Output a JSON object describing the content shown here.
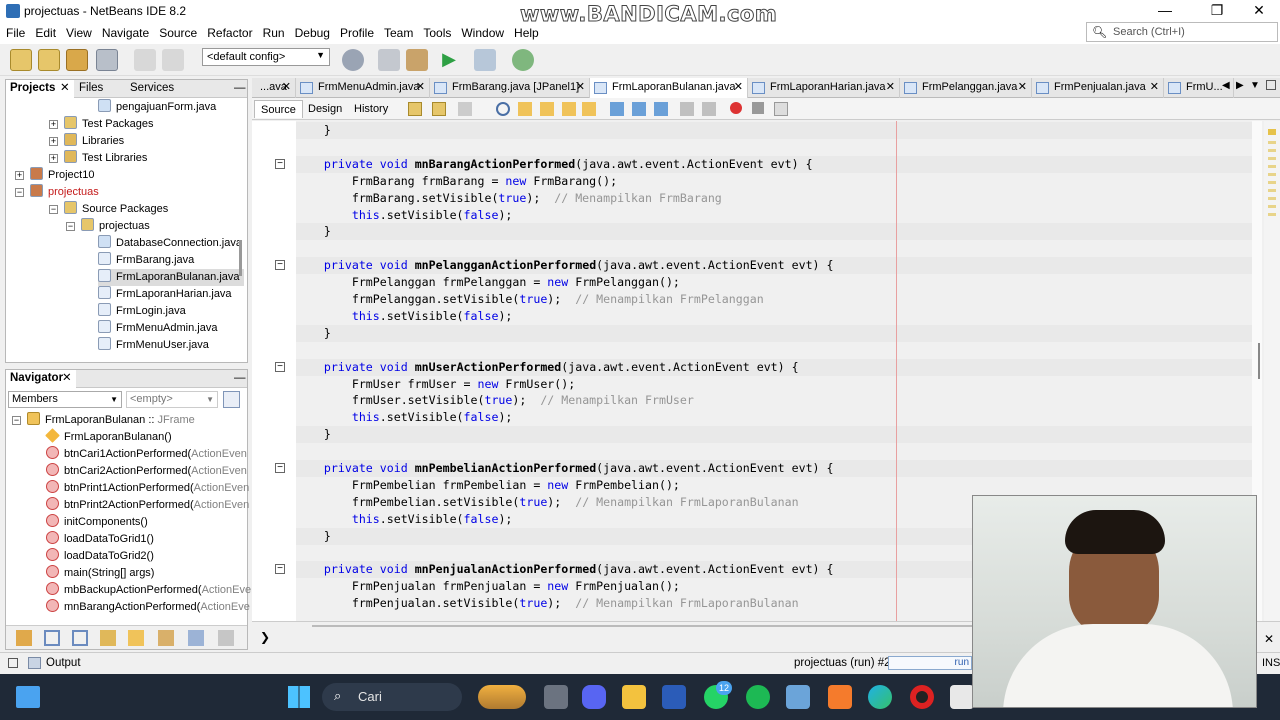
{
  "window": {
    "title": "projectuas - NetBeans IDE 8.2",
    "minimize": "—",
    "maximize": "❐",
    "close": "✕"
  },
  "watermark": "www.BANDICAM.com",
  "menu": [
    "File",
    "Edit",
    "View",
    "Navigate",
    "Source",
    "Refactor",
    "Run",
    "Debug",
    "Profile",
    "Team",
    "Tools",
    "Window",
    "Help"
  ],
  "search": {
    "placeholder": "Search (Ctrl+I)"
  },
  "toolbar": {
    "config": "<default config>"
  },
  "projects_panel": {
    "tabs": [
      "Projects",
      "Files",
      "Services"
    ],
    "minimize": "—",
    "tree": [
      {
        "label": "pengajuanForm.java",
        "indent": 4,
        "icon": "java-file-icon",
        "expander": ""
      },
      {
        "label": "Test Packages",
        "indent": 2,
        "icon": "package-folder-icon",
        "expander": "+"
      },
      {
        "label": "Libraries",
        "indent": 2,
        "icon": "library-icon",
        "expander": "+"
      },
      {
        "label": "Test Libraries",
        "indent": 2,
        "icon": "library-icon",
        "expander": "+"
      },
      {
        "label": "Project10",
        "indent": 0,
        "icon": "project-icon",
        "expander": "+"
      },
      {
        "label": "projectuas",
        "indent": 0,
        "icon": "project-icon",
        "expander": "−",
        "red": true
      },
      {
        "label": "Source Packages",
        "indent": 2,
        "icon": "package-folder-icon",
        "expander": "−"
      },
      {
        "label": "projectuas",
        "indent": 3,
        "icon": "package-icon",
        "expander": "−"
      },
      {
        "label": "DatabaseConnection.java",
        "indent": 4,
        "icon": "java-file-icon",
        "expander": ""
      },
      {
        "label": "FrmBarang.java",
        "indent": 4,
        "icon": "form-file-icon",
        "expander": ""
      },
      {
        "label": "FrmLaporanBulanan.java",
        "indent": 4,
        "icon": "form-file-icon",
        "expander": "",
        "selected": true
      },
      {
        "label": "FrmLaporanHarian.java",
        "indent": 4,
        "icon": "form-file-icon",
        "expander": ""
      },
      {
        "label": "FrmLogin.java",
        "indent": 4,
        "icon": "form-file-icon",
        "expander": ""
      },
      {
        "label": "FrmMenuAdmin.java",
        "indent": 4,
        "icon": "form-file-icon",
        "expander": ""
      },
      {
        "label": "FrmMenuUser.java",
        "indent": 4,
        "icon": "form-file-icon",
        "expander": ""
      }
    ]
  },
  "navigator_panel": {
    "title": "Navigator",
    "minimize": "—",
    "members_select": "Members",
    "filter_select": "<empty>",
    "root": "FrmLaporanBulanan :: ",
    "root_type": "JFrame",
    "items": [
      {
        "name": "FrmLaporanBulanan()",
        "suffix": "",
        "icon": "constructor-icon"
      },
      {
        "name": "btnCari1ActionPerformed(",
        "suffix": "ActionEven",
        "icon": "private-method-icon"
      },
      {
        "name": "btnCari2ActionPerformed(",
        "suffix": "ActionEven",
        "icon": "private-method-icon"
      },
      {
        "name": "btnPrint1ActionPerformed(",
        "suffix": "ActionEven",
        "icon": "private-method-icon"
      },
      {
        "name": "btnPrint2ActionPerformed(",
        "suffix": "ActionEven",
        "icon": "private-method-icon"
      },
      {
        "name": "initComponents()",
        "suffix": "",
        "icon": "private-method-icon"
      },
      {
        "name": "loadDataToGrid1()",
        "suffix": "",
        "icon": "private-method-icon"
      },
      {
        "name": "loadDataToGrid2()",
        "suffix": "",
        "icon": "private-method-icon"
      },
      {
        "name": "main(String[] args)",
        "suffix": "",
        "icon": "static-method-icon"
      },
      {
        "name": "mbBackupActionPerformed(",
        "suffix": "ActionEve",
        "icon": "private-method-icon"
      },
      {
        "name": "mnBarangActionPerformed(",
        "suffix": "ActionEve",
        "icon": "private-method-icon"
      }
    ]
  },
  "editor_tabs": [
    {
      "label": "...ava",
      "active": false
    },
    {
      "label": "FrmMenuAdmin.java",
      "active": false
    },
    {
      "label": "FrmBarang.java [JPanel1]",
      "active": false
    },
    {
      "label": "FrmLaporanBulanan.java",
      "active": true
    },
    {
      "label": "FrmLaporanHarian.java",
      "active": false
    },
    {
      "label": "FrmPelanggan.java",
      "active": false
    },
    {
      "label": "FrmPenjualan.java",
      "active": false
    },
    {
      "label": "FrmU...",
      "active": false
    }
  ],
  "editor_subtabs": [
    "Source",
    "Design",
    "History"
  ],
  "code_lines": [
    {
      "t": "    }",
      "hl": true
    },
    {
      "t": "",
      "hl": false
    },
    {
      "t": "    private void mnBarangActionPerformed(java.awt.event.ActionEvent evt) {",
      "hl": true,
      "fold": true
    },
    {
      "t": "        FrmBarang frmBarang = new FrmBarang();",
      "hl": false
    },
    {
      "t": "        frmBarang.setVisible(true);  // Menampilkan FrmBarang",
      "hl": false
    },
    {
      "t": "        this.setVisible(false);",
      "hl": false
    },
    {
      "t": "    }",
      "hl": true
    },
    {
      "t": "",
      "hl": false
    },
    {
      "t": "    private void mnPelangganActionPerformed(java.awt.event.ActionEvent evt) {",
      "hl": true,
      "fold": true
    },
    {
      "t": "        FrmPelanggan frmPelanggan = new FrmPelanggan();",
      "hl": false
    },
    {
      "t": "        frmPelanggan.setVisible(true);  // Menampilkan FrmPelanggan",
      "hl": false
    },
    {
      "t": "        this.setVisible(false);",
      "hl": false
    },
    {
      "t": "    }",
      "hl": true
    },
    {
      "t": "",
      "hl": false
    },
    {
      "t": "    private void mnUserActionPerformed(java.awt.event.ActionEvent evt) {",
      "hl": true,
      "fold": true
    },
    {
      "t": "        FrmUser frmUser = new FrmUser();",
      "hl": false
    },
    {
      "t": "        frmUser.setVisible(true);  // Menampilkan FrmUser",
      "hl": false
    },
    {
      "t": "        this.setVisible(false);",
      "hl": false
    },
    {
      "t": "    }",
      "hl": true
    },
    {
      "t": "",
      "hl": false
    },
    {
      "t": "    private void mnPembelianActionPerformed(java.awt.event.ActionEvent evt) {",
      "hl": true,
      "fold": true
    },
    {
      "t": "        FrmPembelian frmPembelian = new FrmPembelian();",
      "hl": false
    },
    {
      "t": "        frmPembelian.setVisible(true);  // Menampilkan FrmLaporanBulanan",
      "hl": false
    },
    {
      "t": "        this.setVisible(false);",
      "hl": false
    },
    {
      "t": "    }",
      "hl": true
    },
    {
      "t": "",
      "hl": false
    },
    {
      "t": "    private void mnPenjualanActionPerformed(java.awt.event.ActionEvent evt) {",
      "hl": true,
      "fold": true
    },
    {
      "t": "        FrmPenjualan frmPenjualan = new FrmPenjualan();",
      "hl": false
    },
    {
      "t": "        frmPenjualan.setVisible(true);  // Menampilkan FrmLaporanBulanan",
      "hl": false
    }
  ],
  "output": {
    "label": "Output"
  },
  "status": {
    "run": "projectuas (run) #2",
    "progress_text": "run",
    "ins": "INS"
  },
  "taskbar": {
    "search": "Cari",
    "whatsapp_badge": "12",
    "icons": [
      "task-view-icon",
      "discord-icon",
      "file-explorer-icon",
      "word-icon",
      "whatsapp-icon",
      "spotify-icon",
      "virtualbox-icon",
      "xampp-icon",
      "edge-icon",
      "bandicam-icon",
      "java-icon"
    ]
  },
  "colors": {
    "keyword": "#0000e6",
    "comment": "#969696",
    "highlight": "#e9e9e9",
    "taskbar": "#1f2937"
  }
}
